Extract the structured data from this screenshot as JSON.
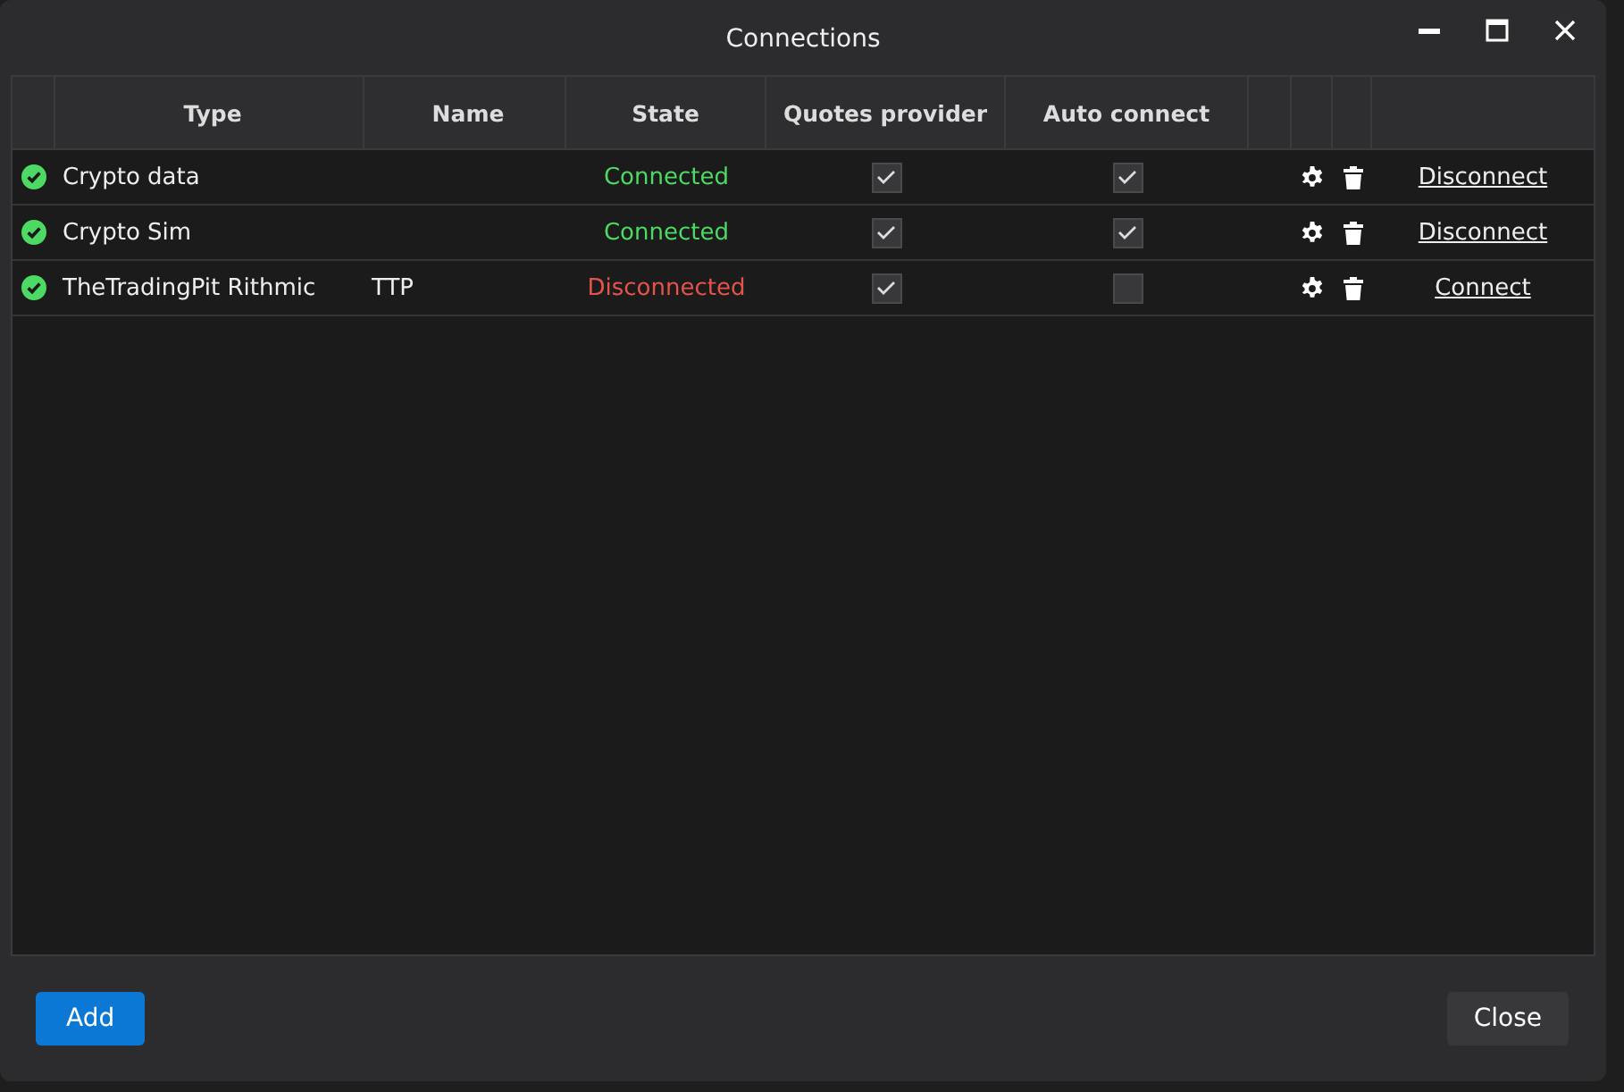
{
  "window": {
    "title": "Connections"
  },
  "table": {
    "columns": [
      "Type",
      "Name",
      "State",
      "Quotes provider",
      "Auto connect"
    ],
    "rows": [
      {
        "type": "Crypto data",
        "name": "",
        "state": "Connected",
        "connected": true,
        "quotes_provider": true,
        "auto_connect": true,
        "action": "Disconnect"
      },
      {
        "type": "Crypto Sim",
        "name": "",
        "state": "Connected",
        "connected": true,
        "quotes_provider": true,
        "auto_connect": true,
        "action": "Disconnect"
      },
      {
        "type": "TheTradingPit Rithmic",
        "name": "TTP",
        "state": "Disconnected",
        "connected": false,
        "quotes_provider": true,
        "auto_connect": false,
        "action": "Connect"
      }
    ]
  },
  "buttons": {
    "add": "Add",
    "close": "Close"
  }
}
